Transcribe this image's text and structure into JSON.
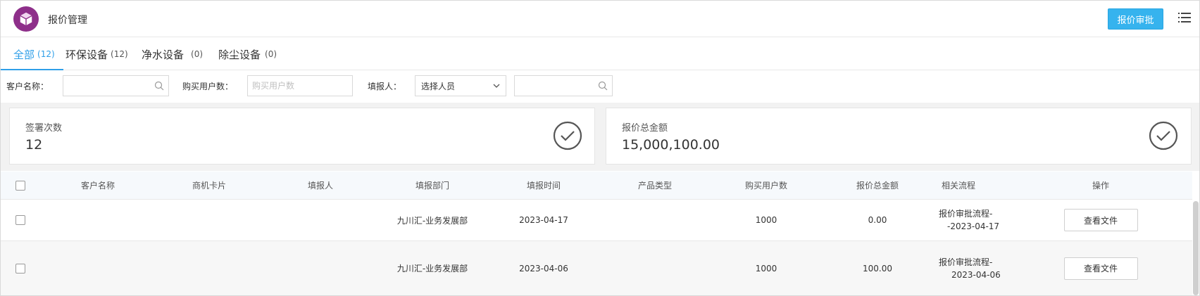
{
  "header": {
    "title": "报价管理",
    "approve_button": "报价审批",
    "logo_icon": "cube-icon",
    "menu_icon": "list-menu-icon",
    "accent": "#36b3ee",
    "logo_color": "#8e2f8a"
  },
  "tabs": [
    {
      "label": "全部",
      "count": "(12)",
      "active": true
    },
    {
      "label": "环保设备",
      "count": "(12)",
      "active": false
    },
    {
      "label": "净水设备",
      "count": "(0)",
      "active": false
    },
    {
      "label": "除尘设备",
      "count": "(0)",
      "active": false
    }
  ],
  "filters": {
    "customer_label": "客户名称：",
    "customer_value": "",
    "buyers_label": "购买用户数：",
    "buyers_placeholder": "购买用户数",
    "reporter_label": "填报人：",
    "reporter_select": "选择人员",
    "extra_value": ""
  },
  "stats": [
    {
      "label": "签署次数",
      "value": "12"
    },
    {
      "label": "报价总金额",
      "value": "15,000,100.00"
    }
  ],
  "table": {
    "columns": [
      "客户名称",
      "商机卡片",
      "填报人",
      "填报部门",
      "填报时间",
      "产品类型",
      "购买用户数",
      "报价总金额",
      "相关流程",
      "操作"
    ],
    "rows": [
      {
        "customer": "",
        "card": "",
        "reporter": "",
        "dept": "九川汇-业务发展部",
        "time": "2023-04-17",
        "product": "",
        "buyers": "1000",
        "amount": "0.00",
        "flow_line1": "报价审批流程-",
        "flow_line2": "-2023-04-17",
        "action": "查看文件"
      },
      {
        "customer": "",
        "card": "",
        "reporter": "",
        "dept": "九川汇-业务发展部",
        "time": "2023-04-06",
        "product": "",
        "buyers": "1000",
        "amount": "100.00",
        "flow_line1": "报价审批流程-",
        "flow_line2": "2023-04-06",
        "action": "查看文件"
      }
    ]
  }
}
